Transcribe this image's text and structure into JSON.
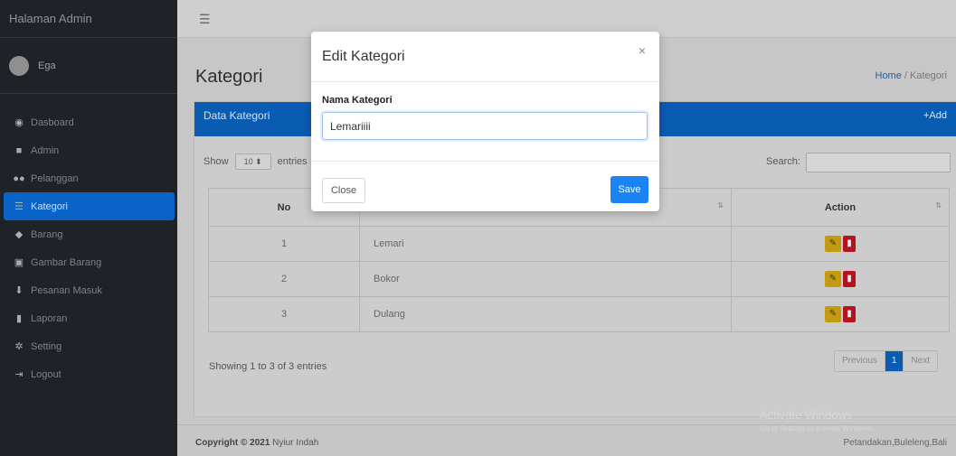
{
  "sidebar": {
    "brand": "Halaman Admin",
    "user_name": "Ega",
    "items": [
      {
        "label": "Dasboard",
        "icon": "dashboard-icon",
        "glyph": "◉"
      },
      {
        "label": "Admin",
        "icon": "user-icon",
        "glyph": "■"
      },
      {
        "label": "Pelanggan",
        "icon": "users-icon",
        "glyph": "●●"
      },
      {
        "label": "Kategori",
        "icon": "list-icon",
        "glyph": "☰"
      },
      {
        "label": "Barang",
        "icon": "cubes-icon",
        "glyph": "◆"
      },
      {
        "label": "Gambar Barang",
        "icon": "image-icon",
        "glyph": "▣"
      },
      {
        "label": "Pesanan Masuk",
        "icon": "download-icon",
        "glyph": "⬇"
      },
      {
        "label": "Laporan",
        "icon": "book-icon",
        "glyph": "▮"
      },
      {
        "label": "Setting",
        "icon": "cog-icon",
        "glyph": "✲"
      },
      {
        "label": "Logout",
        "icon": "logout-icon",
        "glyph": "⇥"
      }
    ]
  },
  "page": {
    "title": "Kategori",
    "breadcrumb_home": "Home",
    "breadcrumb_sep": " / ",
    "breadcrumb_current": "Kategori"
  },
  "card": {
    "title": "Data Kategori",
    "add_label": "+Add",
    "show_label": "Show",
    "entries_value": "10",
    "entries_label": "entries",
    "search_label": "Search:",
    "columns": [
      "No",
      "Action"
    ],
    "rows": [
      {
        "no": "1",
        "name": "Lemari"
      },
      {
        "no": "2",
        "name": "Bokor"
      },
      {
        "no": "3",
        "name": "Dulang"
      }
    ],
    "info": "Showing 1 to 3 of 3 entries",
    "pager": {
      "previous": "Previous",
      "current": "1",
      "next": "Next"
    }
  },
  "footer": {
    "copyright_prefix": "Copyright © 2021",
    "owner": "Nyiur Indah",
    "location": "Petandakan,Buleleng,Bali"
  },
  "watermark": {
    "title": "Activate Windows",
    "subtitle": "Go to Settings to activate Windows."
  },
  "modal": {
    "title": "Edit Kategori",
    "close_glyph": "×",
    "field_label": "Nama Kategori",
    "field_value": "Lemariiii",
    "close_button": "Close",
    "save_button": "Save"
  },
  "colors": {
    "primary": "#0a5cb3",
    "save": "#1a84f4",
    "edit": "#c29b0e",
    "delete": "#b3141d",
    "sidebar": "#1f2327"
  }
}
